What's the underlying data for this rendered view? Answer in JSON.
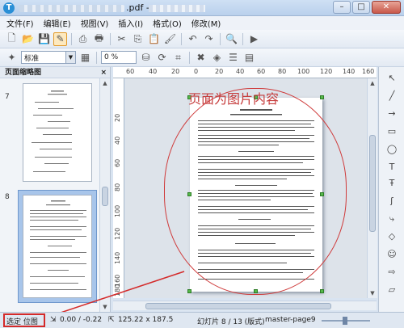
{
  "window": {
    "title_suffix": ".pdf - ",
    "controls": [
      "–",
      "□",
      "✕"
    ]
  },
  "menubar": {
    "items": [
      "文件(F)",
      "编辑(E)",
      "视图(V)",
      "插入(I)",
      "格式(O)",
      "修改(M)"
    ]
  },
  "toolbar2": {
    "style_value": "标准",
    "percent_value": "0 %"
  },
  "panel": {
    "title": "页面缩略图",
    "close": "×",
    "slide_numbers": [
      "7",
      "8"
    ]
  },
  "ruler": {
    "h_labels": [
      "60",
      "40",
      "20",
      "0",
      "20",
      "40",
      "60",
      "80",
      "100",
      "120",
      "140",
      "160"
    ],
    "v_labels": [
      "20",
      "40",
      "60",
      "80",
      "100",
      "120",
      "140",
      "160",
      "180"
    ]
  },
  "annotation": {
    "text": "页面为图片内容"
  },
  "statusbar": {
    "object_type": "选定 位图",
    "position": "0.00 / -0.22",
    "size": "125.22 x 187.5",
    "slide_info": "幻灯片 8 / 13 (版式)",
    "master": "master-page9"
  },
  "colors": {
    "annotation": "#c63c3c",
    "selection": "#a8c5ea",
    "handle": "#56b84b"
  }
}
